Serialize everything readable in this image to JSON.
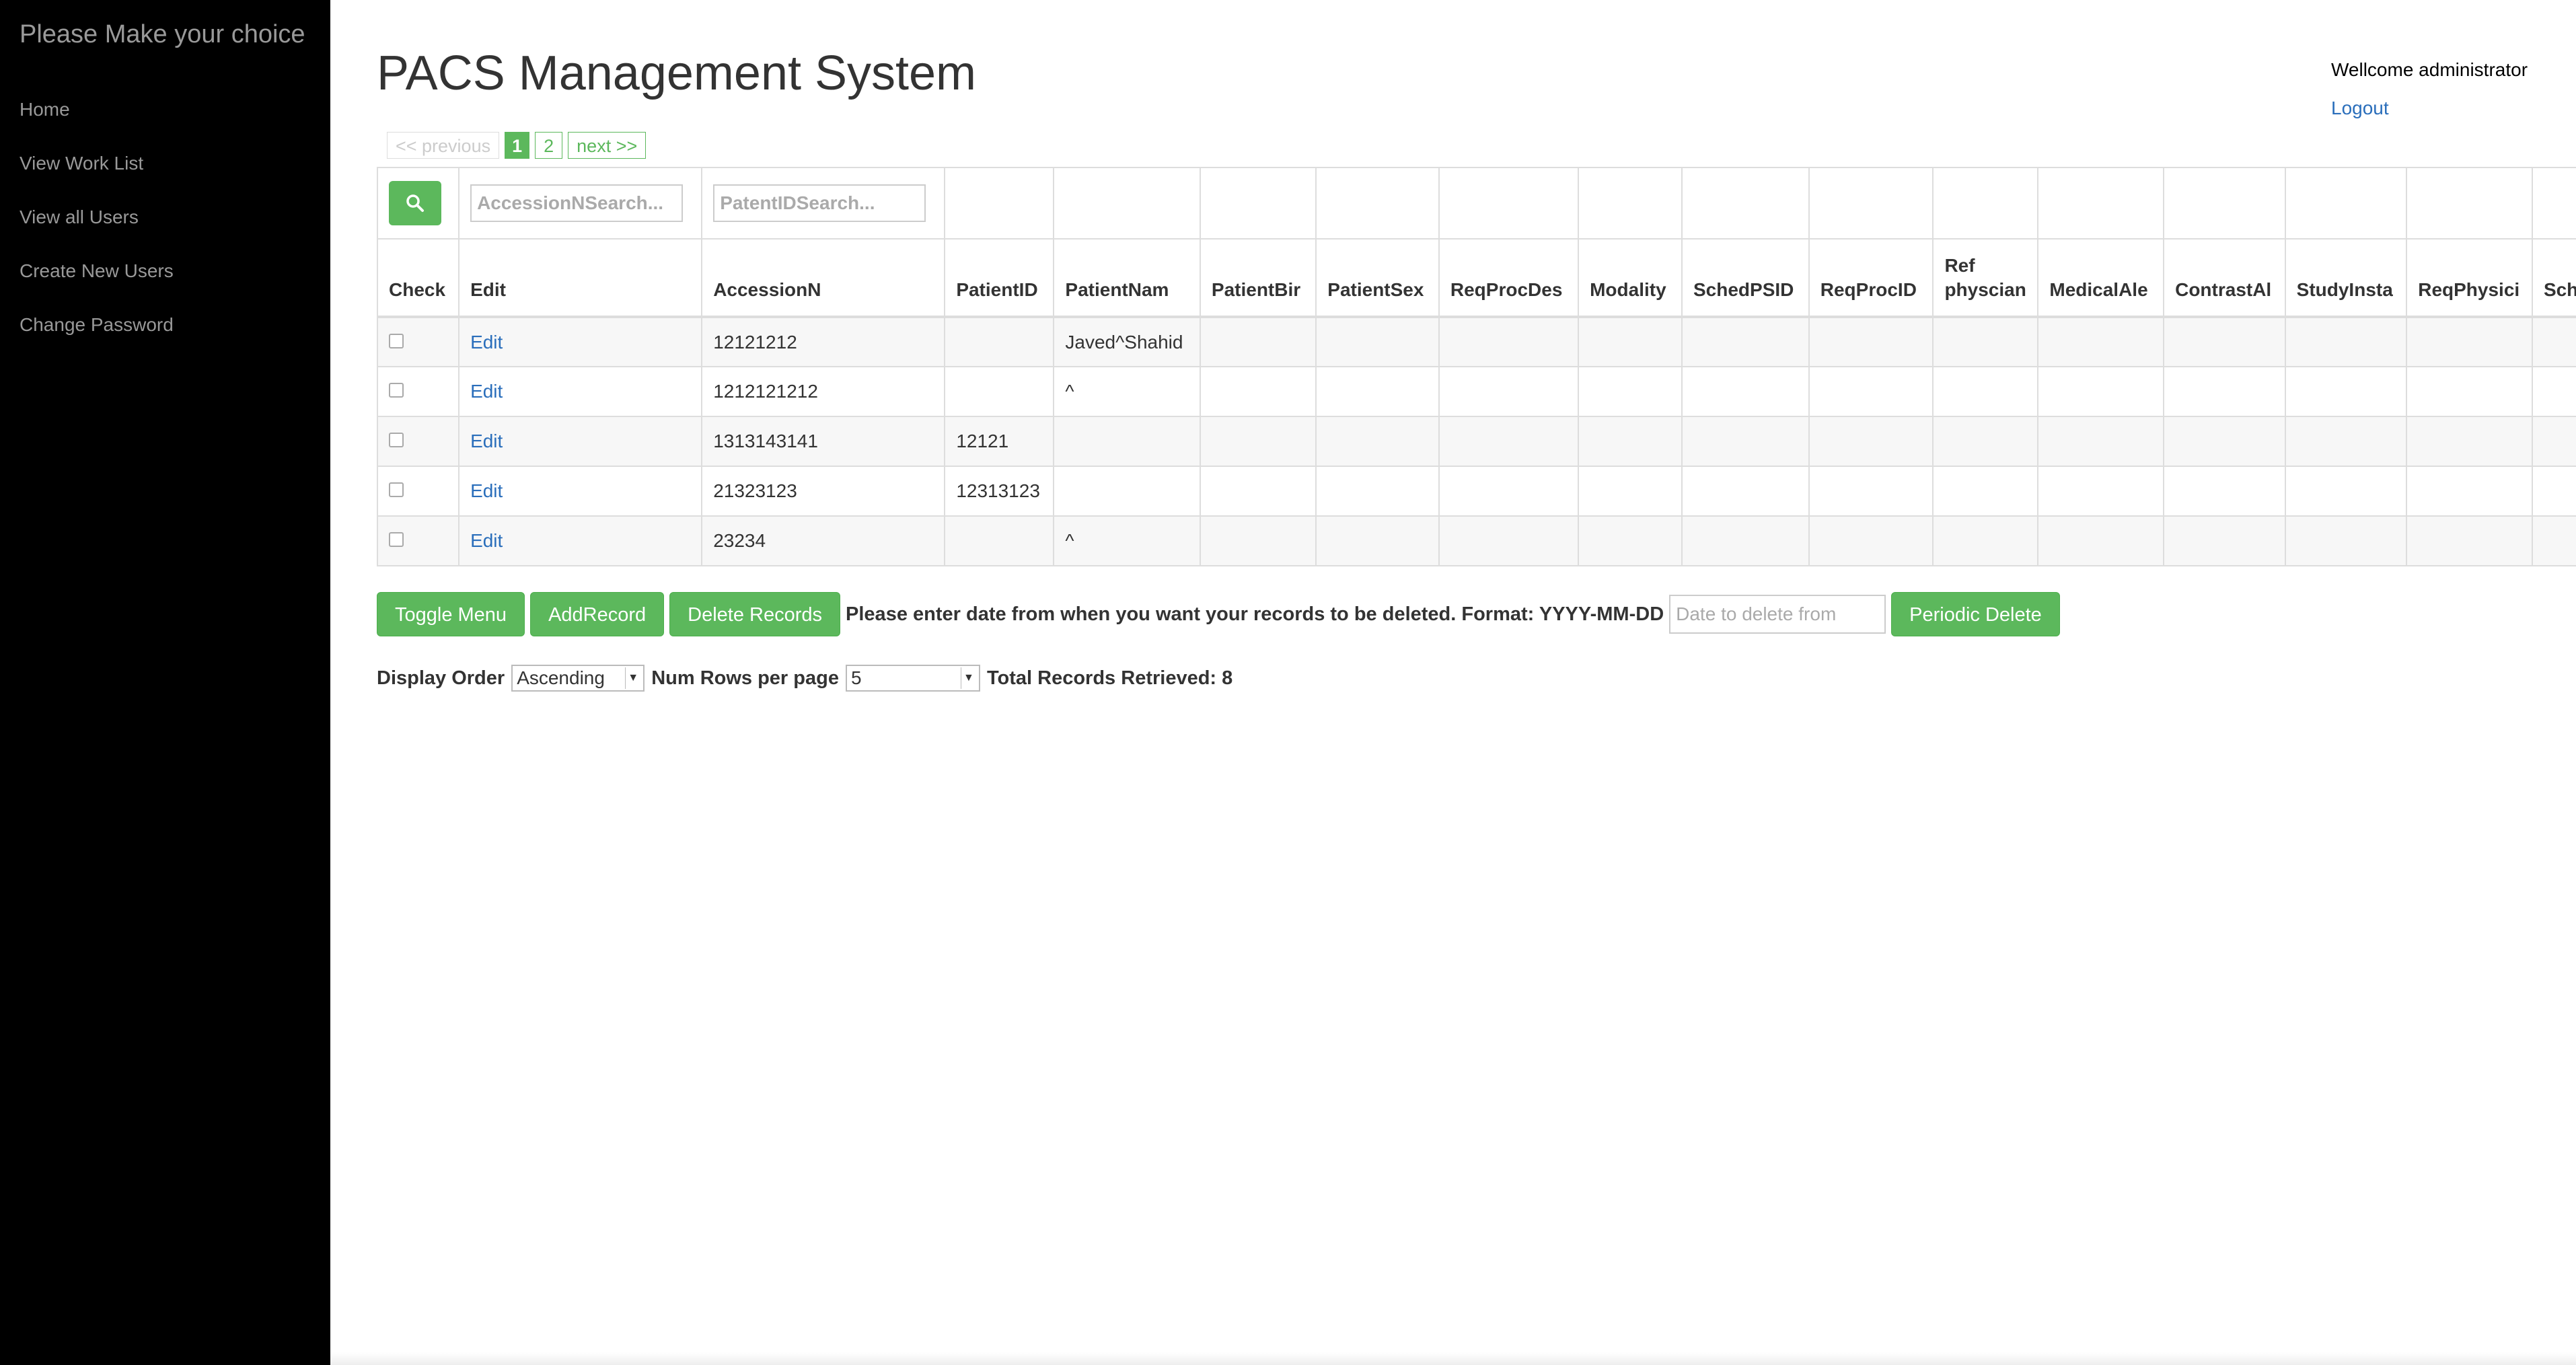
{
  "sidebar": {
    "title": "Please Make your choice",
    "items": [
      {
        "label": "Home"
      },
      {
        "label": "View Work List"
      },
      {
        "label": "View all Users"
      },
      {
        "label": "Create New Users"
      },
      {
        "label": "Change Password"
      }
    ]
  },
  "header": {
    "title": "PACS Management System",
    "welcome": "Wellcome administrator",
    "logout": "Logout"
  },
  "pagination": {
    "previous": "<< previous",
    "pages": [
      "1",
      "2"
    ],
    "current": "1",
    "next": "next >>"
  },
  "search": {
    "accession_placeholder": "AccessionNSearch...",
    "patient_placeholder": "PatentIDSearch..."
  },
  "table": {
    "columns": [
      "Check",
      "Edit",
      "AccessionN",
      "PatientID",
      "PatientNam",
      "PatientBir",
      "PatientSex",
      "ReqProcDes",
      "Modality",
      "SchedPSID",
      "ReqProcID",
      "Ref physcian",
      "MedicalAle",
      "ContrastAl",
      "StudyInsta",
      "ReqPhysici",
      "Scheduled"
    ],
    "rows": [
      {
        "edit": "Edit",
        "accession": "12121212",
        "patient_id": "",
        "patient_name": "Javed^Shahid"
      },
      {
        "edit": "Edit",
        "accession": "1212121212",
        "patient_id": "",
        "patient_name": "^"
      },
      {
        "edit": "Edit",
        "accession": "1313143141",
        "patient_id": "12121",
        "patient_name": ""
      },
      {
        "edit": "Edit",
        "accession": "21323123",
        "patient_id": "12313123",
        "patient_name": ""
      },
      {
        "edit": "Edit",
        "accession": "23234",
        "patient_id": "",
        "patient_name": "^"
      }
    ]
  },
  "actions": {
    "toggle_menu": "Toggle Menu",
    "add_record": "AddRecord",
    "delete_records": "Delete Records",
    "instruction": "Please enter date from when you want your records to be deleted. Format: YYYY-MM-DD",
    "date_placeholder": "Date to delete from",
    "periodic_delete": "Periodic Delete"
  },
  "order": {
    "display_order_label": "Display Order",
    "display_order_value": "Ascending",
    "num_rows_label": "Num Rows per page",
    "num_rows_value": "5",
    "total_label": "Total Records Retrieved: 8"
  },
  "colors": {
    "accent": "#5cb85c",
    "link": "#2a6ebb",
    "sidebar_bg": "#000000"
  }
}
